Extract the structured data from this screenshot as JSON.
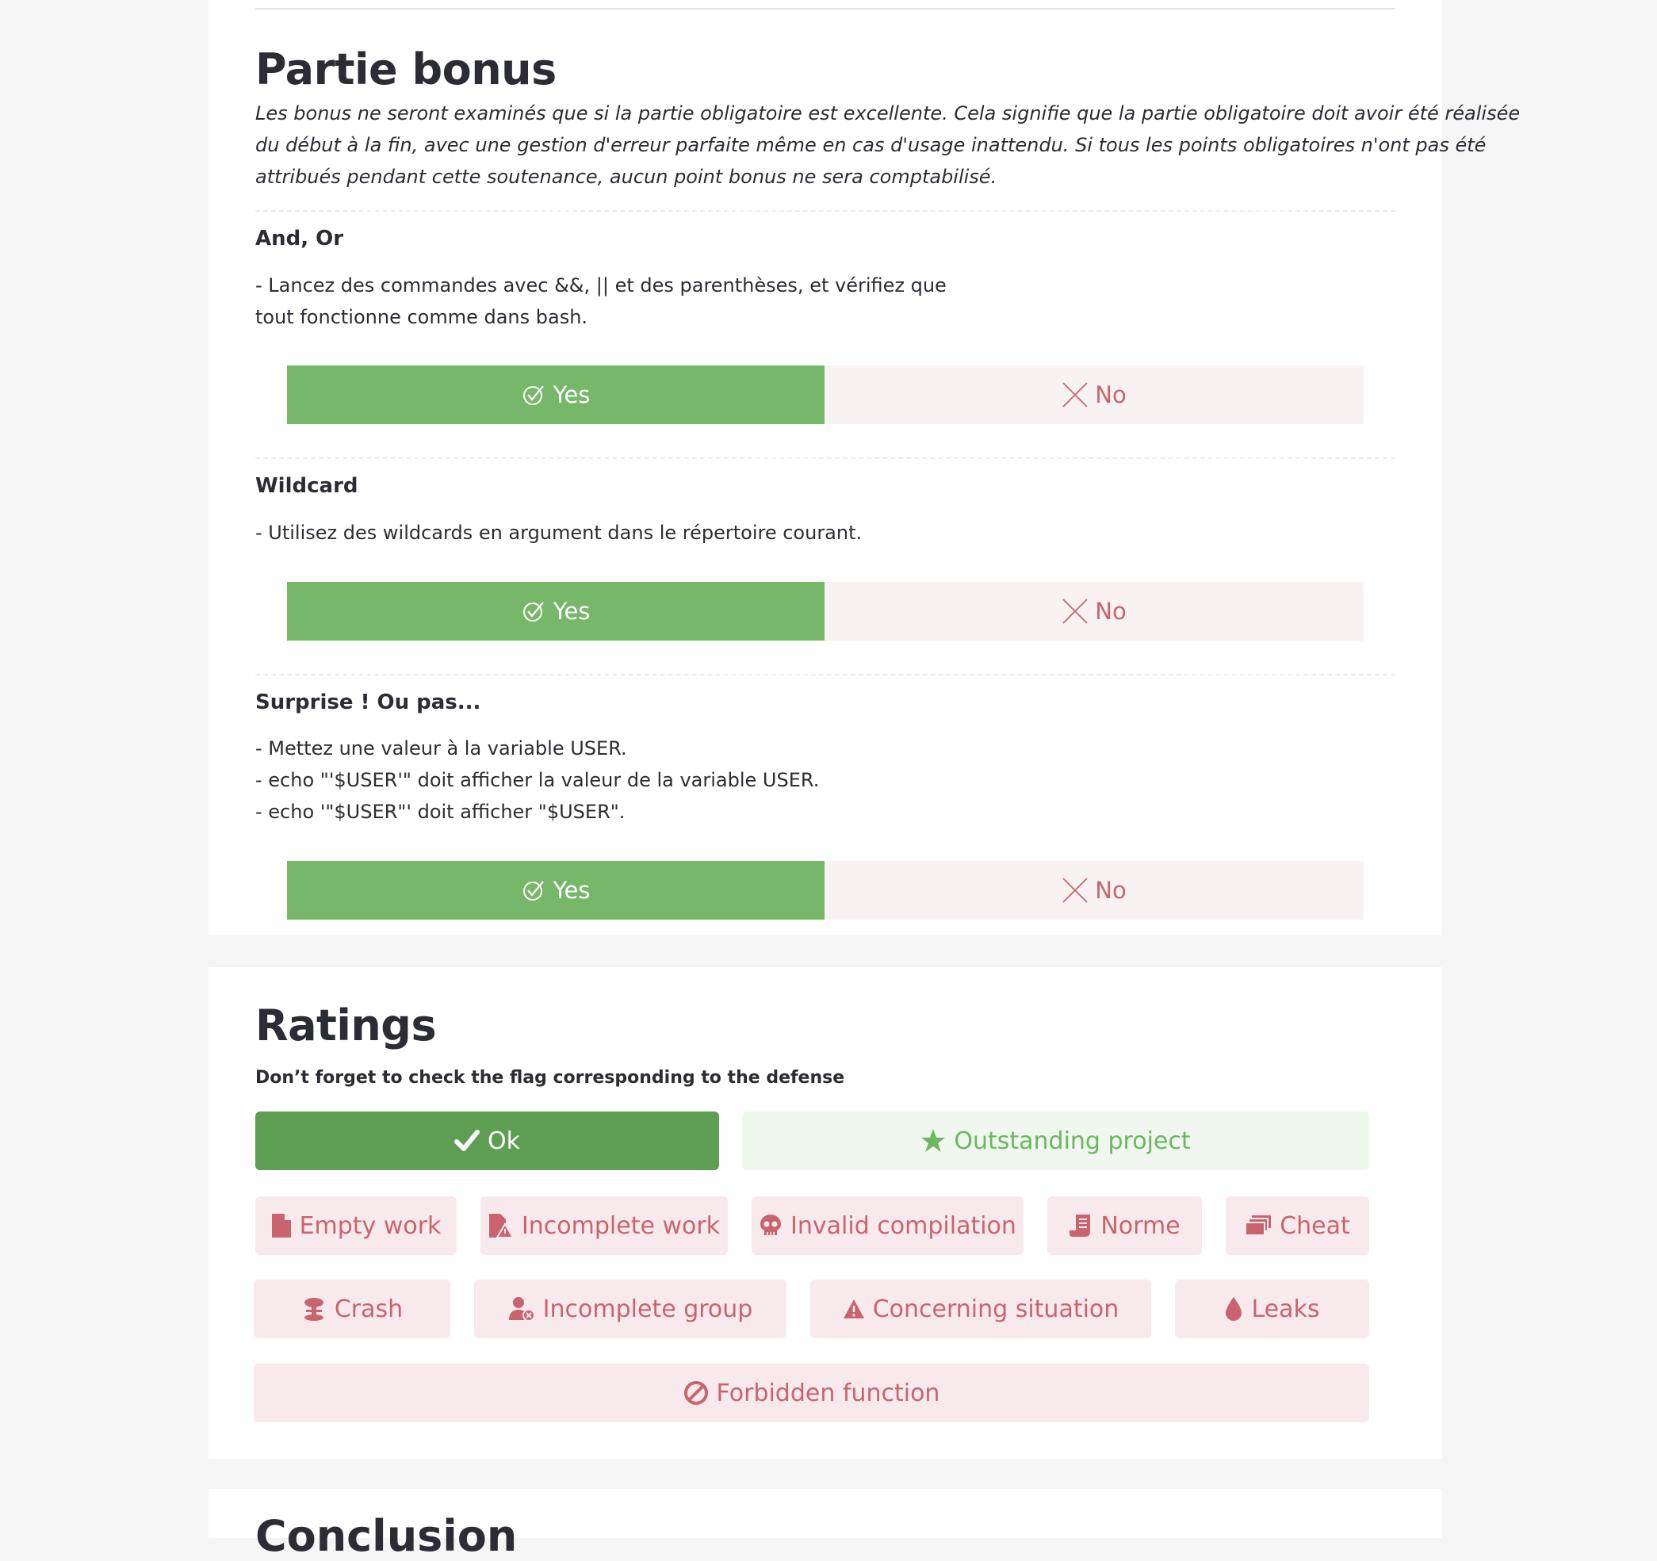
{
  "bonus": {
    "title": "Partie bonus",
    "intro_lines": [
      "Les bonus ne seront examinés que si la partie obligatoire est excellente. Cela signifie que la partie obligatoire doit avoir été réalisée",
      "du début à la fin, avec une gestion d'erreur parfaite même en cas d'usage inattendu. Si tous les points obligatoires n'ont pas été",
      "attribués pendant cette soutenance, aucun point bonus ne sera comptabilisé."
    ],
    "questions": [
      {
        "title": "And, Or",
        "lines": [
          "- Lancez des commandes avec &&, || et des parenthèses, et vérifiez que",
          "tout fonctionne comme dans bash."
        ],
        "yes_label": "Yes",
        "no_label": "No"
      },
      {
        "title": "Wildcard",
        "lines": [
          "- Utilisez des wildcards en argument dans le répertoire courant."
        ],
        "yes_label": "Yes",
        "no_label": "No"
      },
      {
        "title": "Surprise ! Ou pas...",
        "lines": [
          "- Mettez une valeur à la variable USER.",
          "- echo \"'$USER'\" doit afficher la valeur de la variable USER.",
          "- echo '\"$USER\"' doit afficher \"$USER\"."
        ],
        "yes_label": "Yes",
        "no_label": "No"
      }
    ]
  },
  "ratings": {
    "title": "Ratings",
    "subtitle": "Don’t forget to check the flag corresponding to the defense",
    "ok_label": "Ok",
    "outstanding_label": "Outstanding project",
    "flags": {
      "empty_work": "Empty work",
      "incomplete_work": "Incomplete work",
      "invalid_compilation": "Invalid compilation",
      "norme": "Norme",
      "cheat": "Cheat",
      "crash": "Crash",
      "incomplete_group": "Incomplete group",
      "concerning_situation": "Concerning situation",
      "leaks": "Leaks",
      "forbidden_function": "Forbidden function"
    }
  },
  "next_section": {
    "title": "Conclusion"
  },
  "colors": {
    "yes_green": "#77b769",
    "ok_green": "#5d9e53",
    "outstanding_green": "#6db662",
    "flag_red": "#c9646e",
    "flag_bg": "#f8eaec",
    "no_bg": "#f8f2f3"
  },
  "icons": {
    "yes": "check-circle-icon",
    "no": "x-icon",
    "ok": "checkmark-icon",
    "outstanding": "star-icon",
    "empty_work": "file-icon",
    "incomplete_work": "file-warning-icon",
    "invalid_compilation": "skull-icon",
    "norme": "scroll-icon",
    "cheat": "stacked-cards-icon",
    "crash": "explosion-icon",
    "incomplete_group": "user-x-icon",
    "concerning_situation": "warning-triangle-icon",
    "leaks": "droplet-icon",
    "forbidden_function": "ban-icon"
  }
}
